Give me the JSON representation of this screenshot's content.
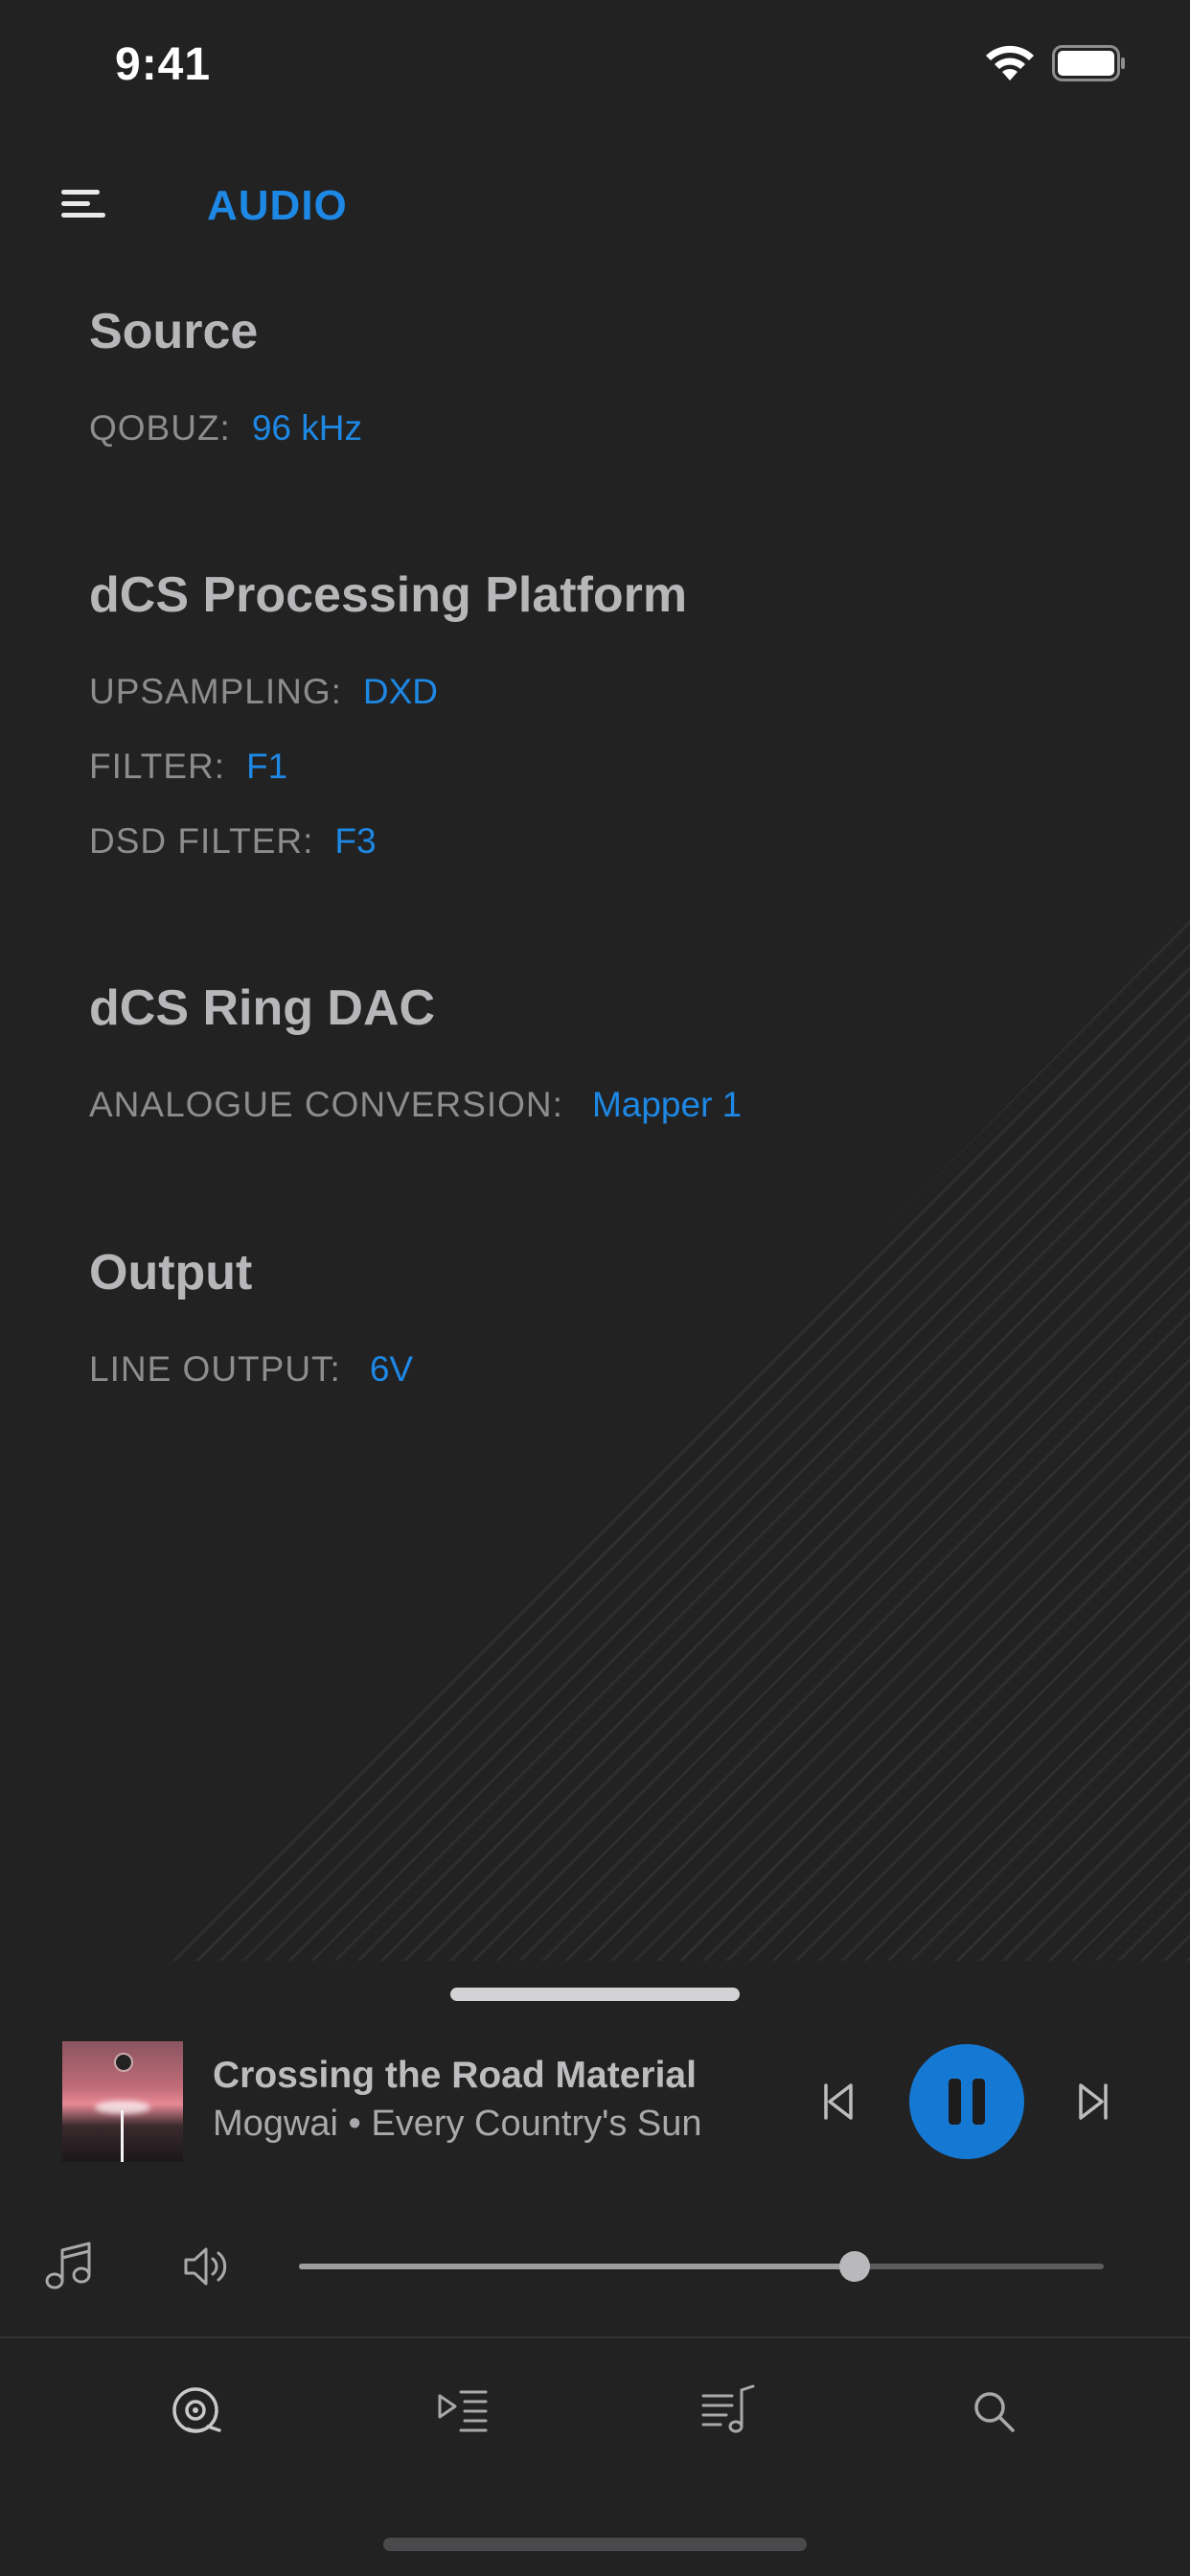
{
  "status_bar": {
    "time": "9:41"
  },
  "header": {
    "title": "AUDIO"
  },
  "sections": {
    "source": {
      "title": "Source",
      "rows": [
        {
          "label": "QOBUZ:",
          "value": "96 kHz"
        }
      ]
    },
    "processing": {
      "title": "dCS Processing Platform",
      "rows": [
        {
          "label": "UPSAMPLING:",
          "value": "DXD"
        },
        {
          "label": "FILTER:",
          "value": "F1"
        },
        {
          "label": "DSD FILTER:",
          "value": "F3"
        }
      ]
    },
    "dac": {
      "title": "dCS Ring DAC",
      "rows": [
        {
          "label": "ANALOGUE CONVERSION:",
          "value": "Mapper 1"
        }
      ]
    },
    "output": {
      "title": "Output",
      "rows": [
        {
          "label": "LINE OUTPUT:",
          "value": "6V"
        }
      ]
    }
  },
  "now_playing": {
    "title": "Crossing the Road Material",
    "subtitle": "Mogwai • Every Country's Sun",
    "state": "playing"
  },
  "volume": {
    "level": 0.69
  },
  "tab_bar": {
    "tabs": [
      {
        "icon": "now-playing-disc-icon",
        "active": true
      },
      {
        "icon": "play-queue-icon",
        "active": false
      },
      {
        "icon": "library-playlist-icon",
        "active": false
      },
      {
        "icon": "search-icon",
        "active": false
      }
    ]
  },
  "colors": {
    "background": "#222223",
    "accent": "#1e88e5",
    "label": "#8d8d8f",
    "heading": "#b7b7b9"
  }
}
